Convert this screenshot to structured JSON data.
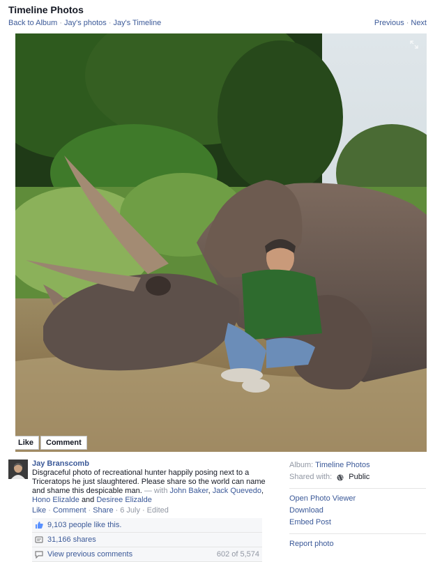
{
  "header": {
    "title": "Timeline Photos",
    "nav_left": [
      "Back to Album",
      "Jay's photos",
      "Jay's Timeline"
    ],
    "nav_right": [
      "Previous",
      "Next"
    ]
  },
  "photo": {
    "alt": "Man sitting next to a triceratops",
    "actions": [
      "Like",
      "Comment"
    ]
  },
  "post": {
    "author": "Jay Branscomb",
    "text": "Disgraceful photo of recreational hunter happily posing next to a Triceratops he just slaughtered. Please share so the world can name and shame this despicable man.",
    "with_prefix": "— with",
    "tagged": [
      "John Baker",
      "Jack Quevedo",
      "Hono Elizalde",
      "Desiree Elizalde"
    ],
    "and_word": "and",
    "meta": {
      "like": "Like",
      "comment": "Comment",
      "share": "Share",
      "date": "6 July",
      "edited": "Edited"
    }
  },
  "ufi": {
    "likes": "9,103 people like this.",
    "shares": "31,166 shares",
    "view_previous": "View previous comments",
    "comment_count": "602 of 5,574"
  },
  "sidebar": {
    "album_label": "Album:",
    "album_name": "Timeline Photos",
    "shared_label": "Shared with:",
    "shared_value": "Public",
    "links": [
      "Open Photo Viewer",
      "Download",
      "Embed Post"
    ],
    "report": "Report photo"
  },
  "colors": {
    "link": "#3b5998",
    "muted": "#9197a3",
    "text": "#141823"
  }
}
